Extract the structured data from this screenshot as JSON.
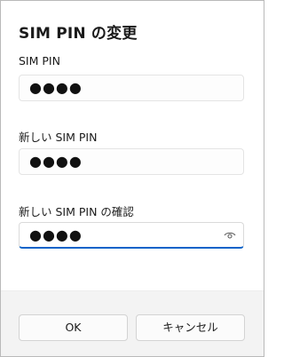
{
  "dialog": {
    "title": "SIM PIN の変更"
  },
  "fields": {
    "current": {
      "label": "SIM PIN",
      "value_masked": "●●●●"
    },
    "new": {
      "label": "新しい SIM PIN",
      "value_masked": "●●●●"
    },
    "confirm": {
      "label": "新しい SIM PIN の確認",
      "value_masked": "●●●●",
      "reveal_icon": "eye-icon"
    }
  },
  "buttons": {
    "ok_label": "OK",
    "cancel_label": "キャンセル"
  },
  "colors": {
    "focus_accent": "#0a63c9",
    "footer_bg": "#f3f3f3"
  }
}
